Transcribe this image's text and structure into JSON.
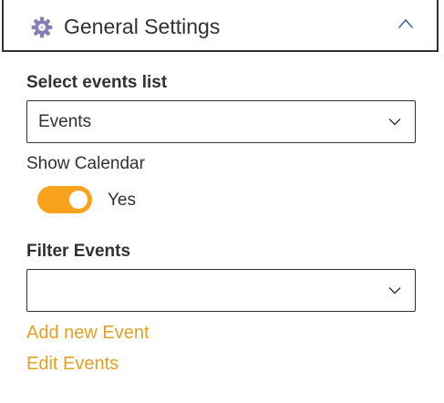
{
  "header": {
    "title": "General Settings",
    "icon": "gear-icon",
    "icon_color": "#8a7fb5",
    "collapse_icon": "chevron-up-icon"
  },
  "events_list": {
    "label": "Select events list",
    "selected": "Events",
    "chevron_icon": "chevron-down-icon"
  },
  "show_calendar": {
    "label": "Show Calendar",
    "on": true,
    "state_text": "Yes",
    "toggle_color": "#f7a21a"
  },
  "filter_events": {
    "label": "Filter Events",
    "selected": "",
    "chevron_icon": "chevron-down-icon"
  },
  "links": {
    "add_event": "Add new Event",
    "edit_events": "Edit Events",
    "color": "#e3a021"
  }
}
